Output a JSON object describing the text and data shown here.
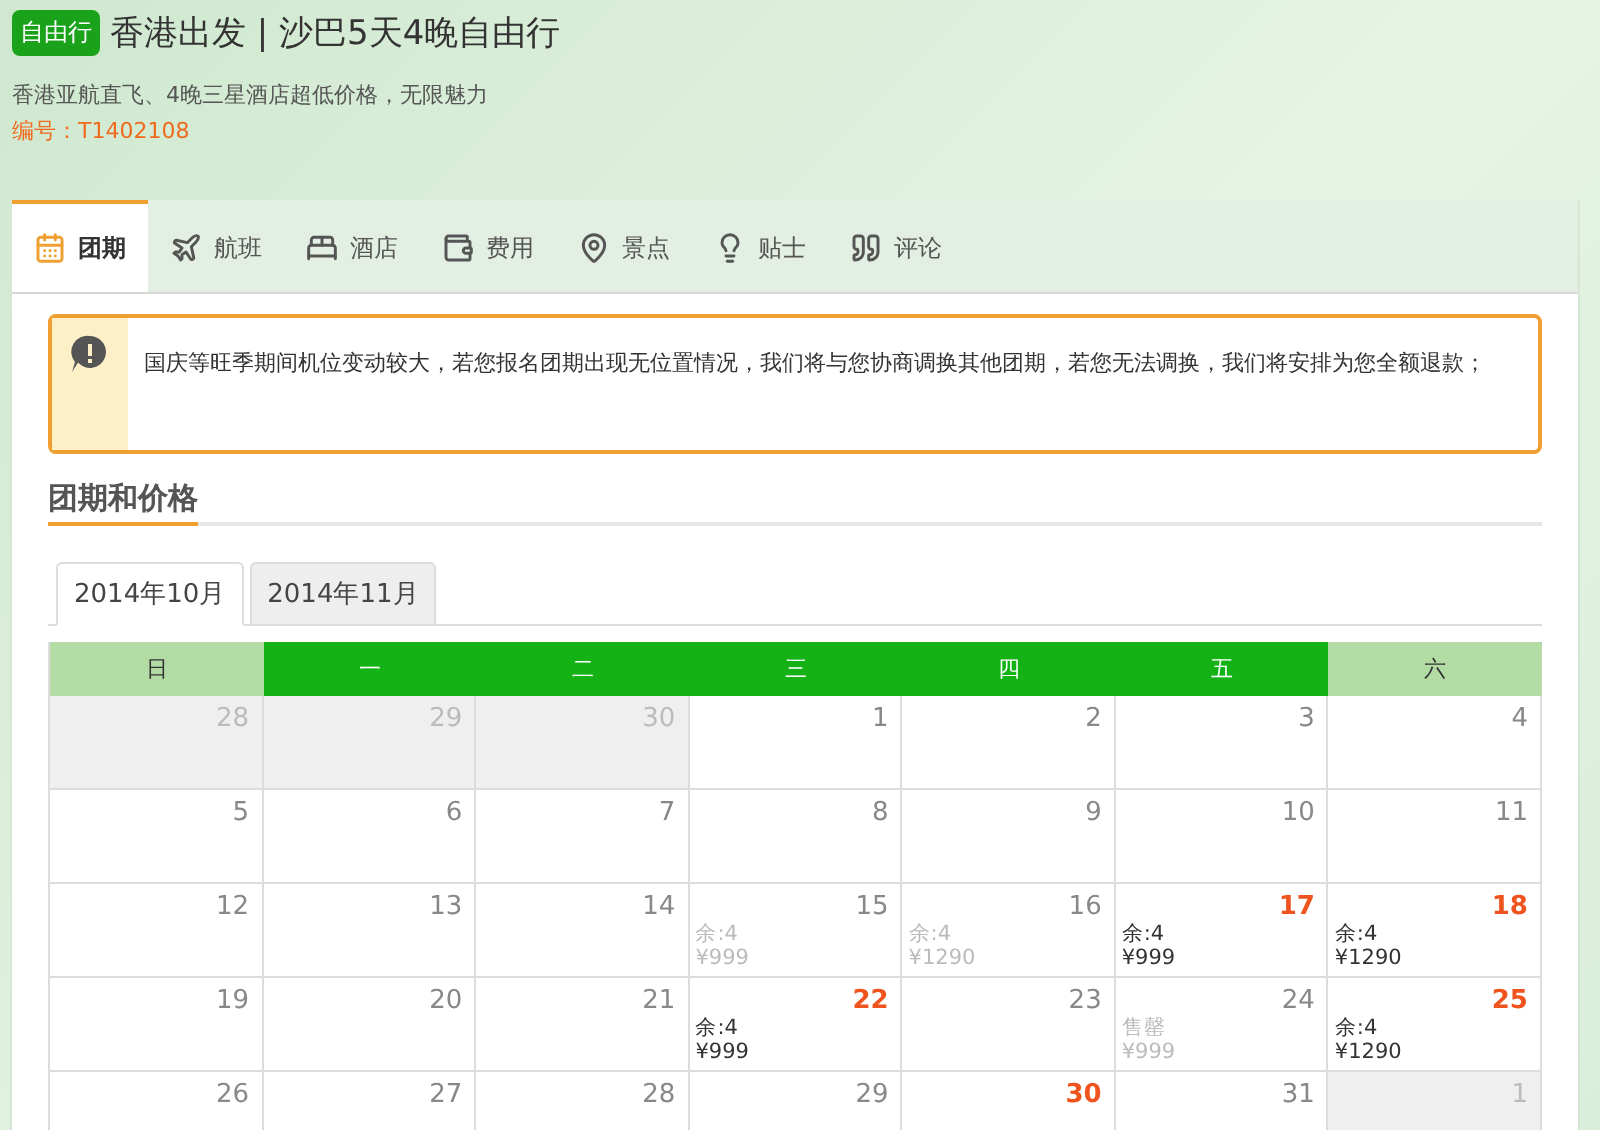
{
  "header": {
    "badge": "自由行",
    "title": "香港出发 | 沙巴5天4晚自由行",
    "subtitle": "香港亚航直飞、4晚三星酒店超低价格，无限魅力",
    "code": "编号：T1402108"
  },
  "tabs": [
    {
      "label": "团期",
      "kind": "calendar",
      "selected": true
    },
    {
      "label": "航班",
      "kind": "plane",
      "selected": false
    },
    {
      "label": "酒店",
      "kind": "bed",
      "selected": false
    },
    {
      "label": "费用",
      "kind": "wallet",
      "selected": false
    },
    {
      "label": "景点",
      "kind": "pin",
      "selected": false
    },
    {
      "label": "贴士",
      "kind": "bulb",
      "selected": false
    },
    {
      "label": "评论",
      "kind": "quote",
      "selected": false
    }
  ],
  "notice": "国庆等旺季期间机位变动较大，若您报名团期出现无位置情况，我们将与您协商调换其他团期，若您无法调换，我们将安排为您全额退款；",
  "section_title": "团期和价格",
  "month_tabs": [
    {
      "label": "2014年10月",
      "selected": true
    },
    {
      "label": "2014年11月",
      "selected": false
    }
  ],
  "weekdays": [
    {
      "label": "日",
      "weekend": true
    },
    {
      "label": "一",
      "weekend": false
    },
    {
      "label": "二",
      "weekend": false
    },
    {
      "label": "三",
      "weekend": false
    },
    {
      "label": "四",
      "weekend": false
    },
    {
      "label": "五",
      "weekend": false
    },
    {
      "label": "六",
      "weekend": true
    }
  ],
  "weeks": [
    [
      {
        "day": "28",
        "kind": "outside"
      },
      {
        "day": "29",
        "kind": "outside"
      },
      {
        "day": "30",
        "kind": "outside"
      },
      {
        "day": "1",
        "kind": "plain"
      },
      {
        "day": "2",
        "kind": "plain"
      },
      {
        "day": "3",
        "kind": "plain"
      },
      {
        "day": "4",
        "kind": "plain"
      }
    ],
    [
      {
        "day": "5",
        "kind": "plain"
      },
      {
        "day": "6",
        "kind": "plain"
      },
      {
        "day": "7",
        "kind": "plain"
      },
      {
        "day": "8",
        "kind": "plain"
      },
      {
        "day": "9",
        "kind": "plain"
      },
      {
        "day": "10",
        "kind": "plain"
      },
      {
        "day": "11",
        "kind": "plain"
      }
    ],
    [
      {
        "day": "12",
        "kind": "plain"
      },
      {
        "day": "13",
        "kind": "plain"
      },
      {
        "day": "14",
        "kind": "plain"
      },
      {
        "day": "15",
        "kind": "expired",
        "status": "余:4",
        "price": "¥999"
      },
      {
        "day": "16",
        "kind": "expired",
        "status": "余:4",
        "price": "¥1290"
      },
      {
        "day": "17",
        "kind": "available",
        "status": "余:4",
        "price": "¥999"
      },
      {
        "day": "18",
        "kind": "available",
        "status": "余:4",
        "price": "¥1290"
      }
    ],
    [
      {
        "day": "19",
        "kind": "plain"
      },
      {
        "day": "20",
        "kind": "plain"
      },
      {
        "day": "21",
        "kind": "plain"
      },
      {
        "day": "22",
        "kind": "available",
        "status": "余:4",
        "price": "¥999"
      },
      {
        "day": "23",
        "kind": "plain"
      },
      {
        "day": "24",
        "kind": "expired",
        "status": "售罄",
        "price": "¥999"
      },
      {
        "day": "25",
        "kind": "available",
        "status": "余:4",
        "price": "¥1290"
      }
    ],
    [
      {
        "day": "26",
        "kind": "plain"
      },
      {
        "day": "27",
        "kind": "plain"
      },
      {
        "day": "28",
        "kind": "plain"
      },
      {
        "day": "29",
        "kind": "plain"
      },
      {
        "day": "30",
        "kind": "available"
      },
      {
        "day": "31",
        "kind": "plain"
      },
      {
        "day": "1",
        "kind": "outside"
      }
    ]
  ]
}
